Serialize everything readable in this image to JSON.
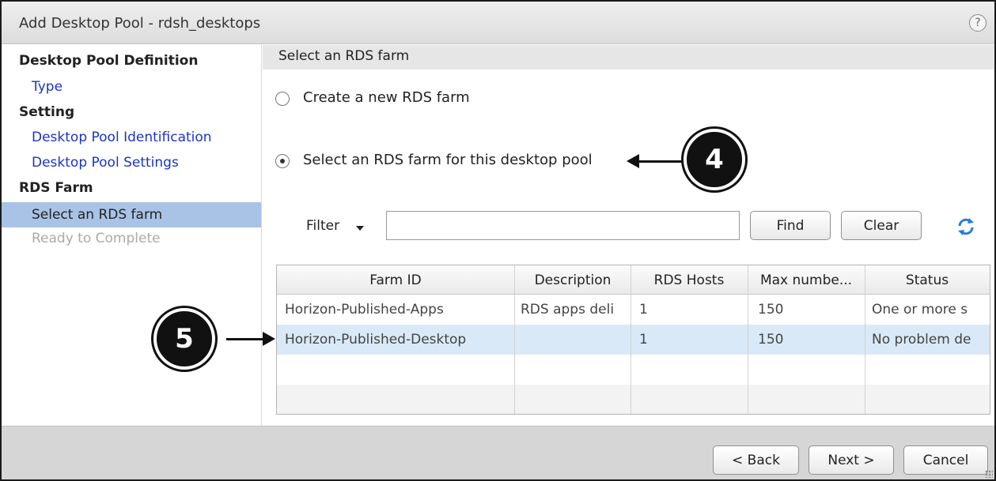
{
  "window": {
    "title": "Add Desktop Pool - rdsh_desktops",
    "help_icon": "?"
  },
  "sidebar": {
    "section1": "Desktop Pool Definition",
    "type_link": "Type",
    "section2": "Setting",
    "identification_link": "Desktop Pool Identification",
    "settings_link": "Desktop Pool Settings",
    "section3": "RDS Farm",
    "active_item": "Select an RDS farm",
    "disabled_item": "Ready to Complete"
  },
  "content": {
    "header": "Select an RDS farm",
    "radio_new": "Create a new RDS farm",
    "radio_select": "Select an RDS farm for this desktop pool",
    "selected_option": "Select an RDS farm for this desktop pool"
  },
  "callouts": {
    "step4": "4",
    "step5": "5"
  },
  "filter": {
    "label": "Filter",
    "input_value": "",
    "find_label": "Find",
    "clear_label": "Clear",
    "refresh_icon": "refresh-icon"
  },
  "grid": {
    "columns": [
      "Farm ID",
      "Description",
      "RDS Hosts",
      "Max numbe...",
      "Status"
    ],
    "rows": [
      [
        "Horizon-Published-Apps",
        "RDS apps deli",
        "1",
        "150",
        "One or more s"
      ],
      [
        "Horizon-Published-Desktop",
        "",
        "1",
        "150",
        "No problem de"
      ]
    ],
    "selected_row_index": 1
  },
  "footer": {
    "back_label": "< Back",
    "next_label": "Next >",
    "cancel_label": "Cancel"
  },
  "colors": {
    "link": "#1a33cc",
    "active_sidebar": "#a9c3e6",
    "selected_row": "#d9e9f8",
    "disabled_text": "#aaaaaa"
  }
}
